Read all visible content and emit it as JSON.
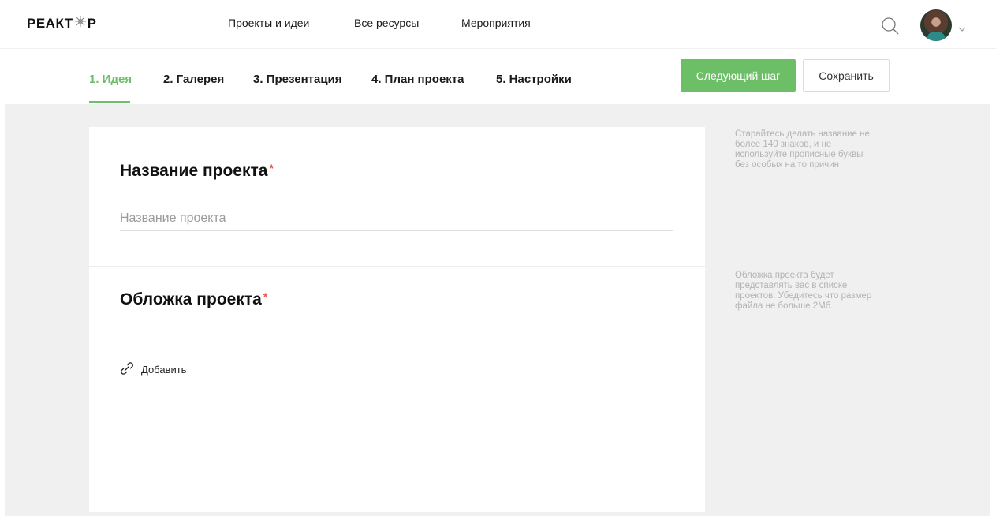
{
  "header": {
    "logo_left": "РЕАКТ",
    "logo_right": "Р",
    "nav": [
      "Проекты и идеи",
      "Все ресурсы",
      "Мероприятия"
    ]
  },
  "steps": {
    "items": [
      "1. Идея",
      "2. Галерея",
      "3. Презентация",
      "4. План проекта",
      "5. Настройки"
    ],
    "active_index": 0,
    "next_label": "Следующий шаг",
    "save_label": "Сохранить"
  },
  "form": {
    "name_title": "Название проекта",
    "required_mark": "*",
    "name_placeholder": "Название проекта",
    "cover_title": "Обложка проекта",
    "add_label": "Добавить"
  },
  "hints": {
    "name": "Старайтесь делать название не более 140 знаков, и не используйте прописные буквы без особых на то причин",
    "cover": "Обложка проекта будет представлять вас в списке проектов. Убедитесь что размер файла не больше 2Мб."
  },
  "colors": {
    "accent": "#6cbf66",
    "required": "#e25555",
    "background": "#f0f0f0"
  },
  "icons": [
    "search-icon",
    "chevron-down-icon",
    "link-icon",
    "avatar"
  ]
}
